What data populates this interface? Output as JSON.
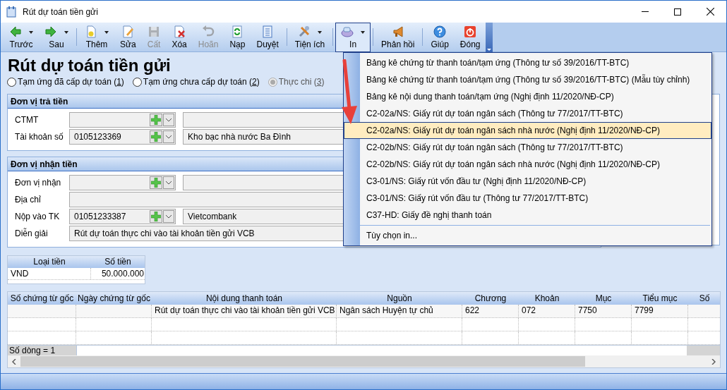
{
  "window": {
    "title": "Rút dự toán tiền gửi"
  },
  "toolbar": [
    [
      {
        "label": "Trước",
        "dropdown": true,
        "disabled": false,
        "selected": false
      },
      {
        "label": "Sau",
        "dropdown": true,
        "disabled": false,
        "selected": false
      }
    ],
    [
      {
        "label": "Thêm",
        "dropdown": true,
        "disabled": false,
        "selected": false
      },
      {
        "label": "Sửa",
        "dropdown": false,
        "disabled": false,
        "selected": false
      },
      {
        "label": "Cất",
        "dropdown": false,
        "disabled": true,
        "selected": false
      },
      {
        "label": "Xóa",
        "dropdown": false,
        "disabled": false,
        "selected": false
      },
      {
        "label": "Hoãn",
        "dropdown": false,
        "disabled": true,
        "selected": false
      },
      {
        "label": "Nạp",
        "dropdown": false,
        "disabled": false,
        "selected": false
      },
      {
        "label": "Duyệt",
        "dropdown": false,
        "disabled": false,
        "selected": false
      }
    ],
    [
      {
        "label": "Tiện ích",
        "dropdown": true,
        "disabled": false,
        "selected": false
      }
    ],
    [
      {
        "label": "In",
        "dropdown": true,
        "disabled": false,
        "selected": true
      }
    ],
    [
      {
        "label": "Phản hồi",
        "dropdown": false,
        "disabled": false,
        "selected": false
      }
    ],
    [
      {
        "label": "Giúp",
        "dropdown": false,
        "disabled": false,
        "selected": false
      },
      {
        "label": "Đóng",
        "dropdown": false,
        "disabled": false,
        "selected": false
      }
    ]
  ],
  "heading": "Rút dự toán tiền gửi",
  "radios": [
    {
      "text_before": "Tạm ứng đã cấp dự toán (",
      "mnemonic": "1",
      "text_after": ")",
      "selected": false,
      "disabled": false
    },
    {
      "text_before": "Tạm ứng chưa cấp dự toán (",
      "mnemonic": "2",
      "text_after": ")",
      "selected": false,
      "disabled": false
    },
    {
      "text_before": "Thực chi (",
      "mnemonic": "3",
      "text_after": ")",
      "selected": true,
      "disabled": true
    }
  ],
  "sections": [
    {
      "title": "Đơn vị trả tiền",
      "fields": [
        {
          "kind": "combo",
          "label": "CTMT"
        },
        {
          "kind": "combo",
          "label": "Tài khoản số",
          "value": "0105123369",
          "name_value": "Kho bạc nhà nước Ba Đình"
        }
      ]
    },
    {
      "title": "Đơn vị nhận tiền",
      "fields": [
        {
          "kind": "combo",
          "label": "Đơn vị nhận"
        },
        {
          "kind": "text",
          "label": "Địa chỉ"
        },
        {
          "kind": "combo",
          "label": "Nộp vào TK",
          "value": "01051233387",
          "name_value": "Vietcombank"
        },
        {
          "kind": "text",
          "label": "Diễn giải",
          "value": "Rút dự toán thực chi vào tài khoản tiền gửi VCB"
        }
      ]
    }
  ],
  "currency_table": {
    "columns": [
      "Loại tiền",
      "Số tiền"
    ],
    "rows": [
      [
        "VND",
        "50.000.000"
      ]
    ]
  },
  "detail_table": {
    "columns": [
      "Số chứng từ gốc",
      "Ngày chứng từ gốc",
      "Nội dung thanh toán",
      "Nguồn",
      "Chương",
      "Khoản",
      "Mục",
      "Tiểu mục",
      "Số"
    ],
    "rows": [
      [
        "",
        "",
        "Rút dự toán thực chi vào tài khoản tiền gửi VCB",
        "Ngân sách Huyện tự chủ",
        "622",
        "072",
        "7750",
        "7799",
        ""
      ],
      [
        "",
        "",
        "",
        "",
        "",
        "",
        "",
        "",
        ""
      ],
      [
        "",
        "",
        "",
        "",
        "",
        "",
        "",
        "",
        ""
      ]
    ],
    "footer": "Số dòng = 1"
  },
  "print_menu": {
    "items": [
      {
        "label": "Bảng kê chứng từ thanh toán/tạm ứng (Thông tư số 39/2016/TT-BTC)",
        "selected": false
      },
      {
        "label": "Bảng kê chứng từ thanh toán/tạm ứng (Thông tư số 39/2016/TT-BTC) (Mẫu tùy chỉnh)",
        "selected": false
      },
      {
        "label": "Bảng kê nội dung thanh toán/tạm ứng (Nghị định 11/2020/NĐ-CP)",
        "selected": false
      },
      {
        "label": "C2-02a/NS: Giấy rút dự toán ngân sách (Thông tư 77/2017/TT-BTC)",
        "selected": false
      },
      {
        "label": "C2-02a/NS: Giấy rút dự toán ngân sách nhà nước (Nghị định 11/2020/NĐ-CP)",
        "selected": true
      },
      {
        "label": "C2-02b/NS: Giấy rút dự toán ngân sách (Thông tư 77/2017/TT-BTC)",
        "selected": false
      },
      {
        "label": "C2-02b/NS: Giấy rút dự toán ngân sách nhà nước (Nghị định 11/2020/NĐ-CP)",
        "selected": false
      },
      {
        "label": "C3-01/NS: Giấy rút vốn đầu tư (Nghị định 11/2020/NĐ-CP)",
        "selected": false
      },
      {
        "label": "C3-01/NS: Giấy rút vốn đầu tư (Thông tư 77/2017/TT-BTC)",
        "selected": false
      },
      {
        "label": "C37-HD: Giấy đề nghị thanh toán",
        "selected": false
      }
    ],
    "options_item": {
      "label": "Tùy chọn in...",
      "selected": false
    }
  }
}
